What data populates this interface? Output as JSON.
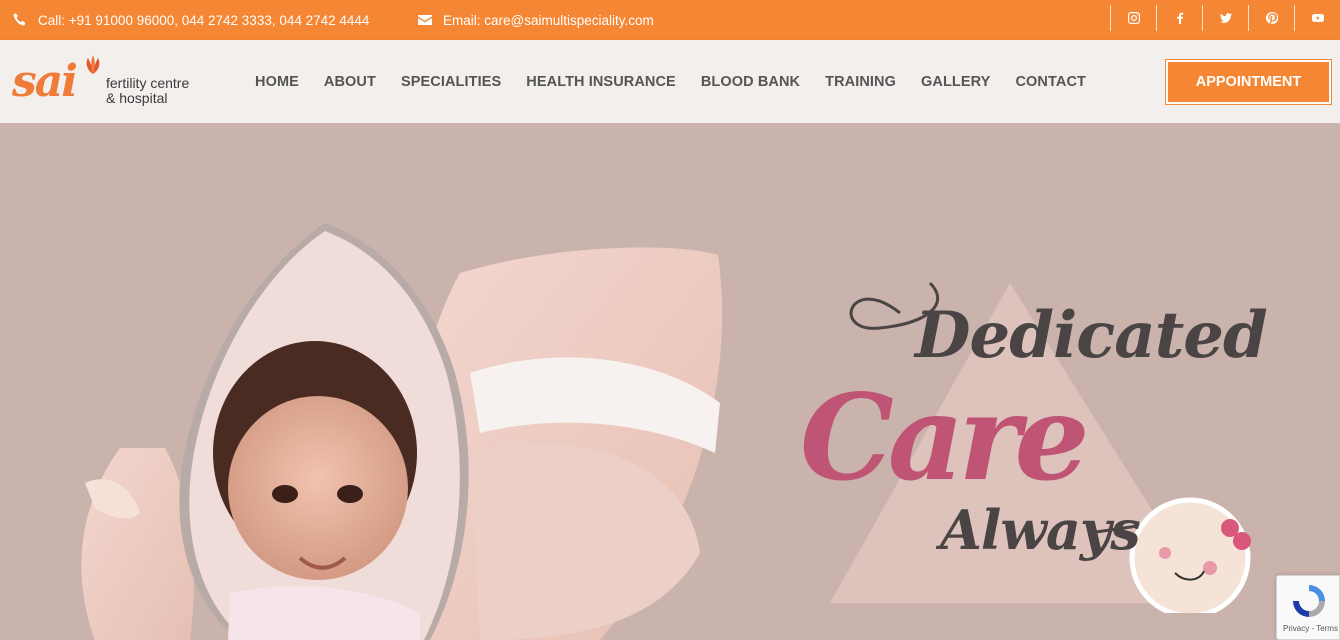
{
  "topbar": {
    "call": "Call: +91 91000 96000, 044 2742 3333, 044 2742 4444",
    "email": "Email: care@saimultispeciality.com",
    "socials": [
      "instagram-icon",
      "facebook-icon",
      "twitter-icon",
      "pinterest-icon",
      "youtube-icon"
    ]
  },
  "logo": {
    "word": "sai",
    "line1": "fertility centre",
    "line2": "& hospital"
  },
  "nav": [
    "HOME",
    "ABOUT",
    "SPECIALITIES",
    "HEALTH INSURANCE",
    "BLOOD BANK",
    "TRAINING",
    "GALLERY",
    "CONTACT"
  ],
  "appointment": "APPOINTMENT",
  "hero": {
    "line1": "Dedicated",
    "line2": "Care",
    "line3": "Always"
  },
  "recaptcha": "Privacy - Terms",
  "colors": {
    "accent": "#f58633",
    "header_bg": "#f2efed",
    "hero_bg": "#cab3ad",
    "care_pink": "#c05474"
  }
}
